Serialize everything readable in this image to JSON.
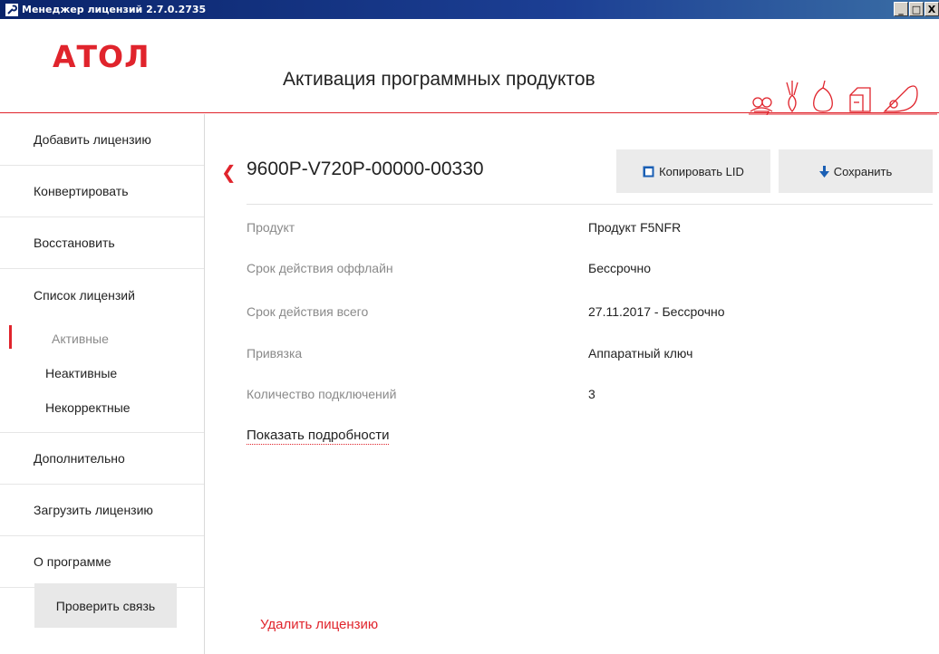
{
  "window": {
    "title": "Менеджер лицензий 2.7.0.2735",
    "controls": [
      "_",
      "□",
      "X"
    ]
  },
  "header": {
    "logo": "АТОЛ",
    "title": "Активация программных продуктов"
  },
  "sidebar": {
    "items_top": [
      "Добавить лицензию",
      "Конвертировать",
      "Восстановить"
    ],
    "license_list": {
      "title": "Список лицензий",
      "sub": [
        "Активные",
        "Неактивные",
        "Некорректные"
      ]
    },
    "items_bottom": [
      "Дополнительно",
      "Загрузить лицензию",
      "О программе"
    ],
    "check_button": "Проверить связь"
  },
  "license": {
    "id": "9600P-V720P-00000-00330",
    "copy_button": "Копировать LID",
    "save_button": "Сохранить",
    "properties": [
      {
        "label": "Продукт",
        "value": "Продукт F5NFR"
      },
      {
        "label": "Срок действия оффлайн",
        "value": "Бессрочно"
      },
      {
        "label": "Срок действия всего",
        "value": "27.11.2017 - Бессрочно"
      },
      {
        "label": "Привязка",
        "value": "Аппаратный ключ"
      },
      {
        "label": "Количество подключений",
        "value": "3"
      }
    ],
    "details_link": "Показать подробности",
    "delete_link": "Удалить лицензию"
  },
  "colors": {
    "accent": "#e0242c",
    "titlebar": "#0a246a",
    "button_bg": "#ebebeb",
    "copy_icon": "#1a5fb4",
    "save_icon": "#1a5fb4"
  }
}
